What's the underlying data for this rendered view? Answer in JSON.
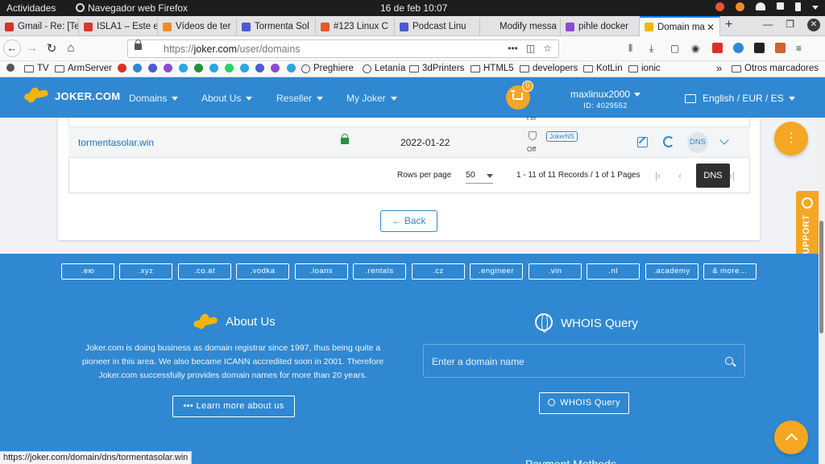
{
  "system": {
    "activities": "Actividades",
    "app_name": "Navegador web Firefox",
    "clock": "16 de feb  10:07"
  },
  "tabs": [
    {
      "label": "Gmail - Re: [Te",
      "color": "#d93025"
    },
    {
      "label": "ISLA1 – Este e",
      "color": "#d33b2c"
    },
    {
      "label": "Vídeos de ter",
      "color": "#f28c28"
    },
    {
      "label": "Tormenta Sol",
      "color": "#4a5bd4"
    },
    {
      "label": "#123 Linux C",
      "color": "#e8572a"
    },
    {
      "label": "Podcast Linu",
      "color": "#4a5bd4"
    },
    {
      "label": "Modify messa",
      "color": "#e3e3e5"
    },
    {
      "label": "pihle docker",
      "color": "#8e4ad4"
    },
    {
      "label": "Domain ma",
      "color": "#f5b40c"
    }
  ],
  "browser": {
    "url_prefix": "https://",
    "url_host": "joker.com",
    "url_path": "/user/domains",
    "url_actions": "•••",
    "status_url": "https://joker.com/domain/dns/tormentasolar.win"
  },
  "bookmarks": [
    {
      "label": "TV",
      "type": "folder"
    },
    {
      "label": "ArmServer",
      "type": "folder"
    },
    {
      "label": "Preghiere",
      "type": "site"
    },
    {
      "label": "Letanía",
      "type": "site"
    },
    {
      "label": "3dPrinters",
      "type": "folder"
    },
    {
      "label": "HTML5",
      "type": "folder"
    },
    {
      "label": "developers",
      "type": "folder"
    },
    {
      "label": "KotLin",
      "type": "folder"
    },
    {
      "label": "ionic",
      "type": "folder"
    }
  ],
  "bookmarks_overflow": "»",
  "bookmarks_other": "Otros marcadores",
  "header": {
    "logo": "JOKER.COM",
    "nav": [
      "Domains",
      "About Us",
      "Reseller",
      "My Joker"
    ],
    "cart_count": "0",
    "username": "maxlinux2000",
    "user_id": "ID: 4029552",
    "locale": "English / EUR / ES"
  },
  "domains_table": {
    "rows": [
      {
        "domain": "tormentasolar.win",
        "expires": "2022-01-22",
        "autorenew": "Off",
        "nameserver": "JokerNS",
        "dns_label": "DNS"
      }
    ],
    "row_above_autorenew": "Off",
    "rows_per_page_label": "Rows per page",
    "rows_per_page": "50",
    "records_info": "1 - 11 of 11 Records / 1 of 1 Pages",
    "tooltip": "DNS"
  },
  "back_label": "← Back",
  "fab_menu": "⋮",
  "support_label": "SUPPORT",
  "footer": {
    "tlds": [
      ".ею",
      ".xyz",
      ".co.at",
      ".vodka",
      ".loans",
      ".rentals",
      ".cz",
      ".engineer",
      ".vin",
      ".nl",
      ".academy",
      "& more…"
    ],
    "about_title": "About Us",
    "about_text": "Joker.com is doing business as domain registrar since 1997, thus being quite a pioneer in this area. We also became ICANN accredited soon in 2001. Therefore Joker.com successfully provides domain names for more than 20 years.",
    "learn_more": "••• Learn more about us",
    "whois_title": "WHOIS Query",
    "whois_placeholder": "Enter a domain name",
    "whois_button": "WHOIS Query",
    "partial_right": "Payment Methods"
  },
  "colors": {
    "brand_blue": "#2f88d1",
    "accent_orange": "#f5a623",
    "logo_yellow": "#f5b40c",
    "lock_green": "#23923d"
  }
}
